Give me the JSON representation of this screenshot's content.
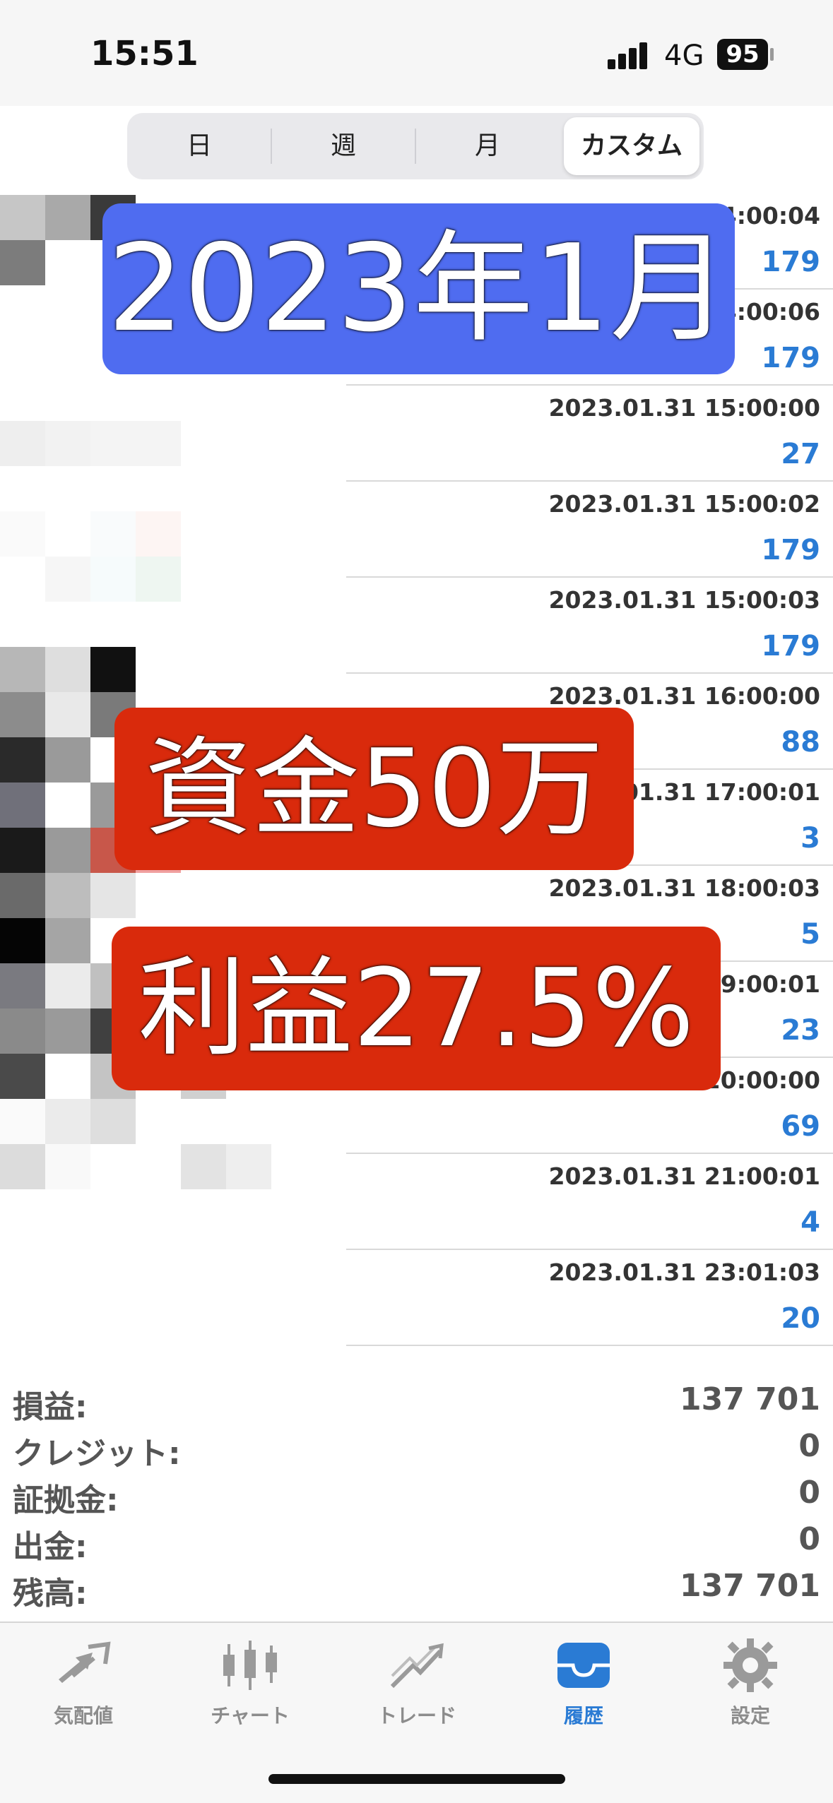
{
  "status_bar": {
    "time": "15:51",
    "network": "4G",
    "battery": "95"
  },
  "segmented": {
    "items": [
      "日",
      "週",
      "月",
      "カスタム"
    ],
    "selected": "カスタム"
  },
  "rows": [
    {
      "date": "14:00:04",
      "value": "179"
    },
    {
      "date": "14:00:06",
      "value": "179"
    },
    {
      "date": "2023.01.31 15:00:00",
      "value": "27"
    },
    {
      "date": "2023.01.31 15:00:02",
      "value": "179"
    },
    {
      "date": "2023.01.31 15:00:03",
      "value": "179"
    },
    {
      "date": "2023.01.31 16:00:00",
      "value": "88"
    },
    {
      "date": "2023.01.31 17:00:01",
      "value": "3"
    },
    {
      "date": "2023.01.31 18:00:03",
      "value": "5"
    },
    {
      "date": "19:00:01",
      "value": "23"
    },
    {
      "date": "2023.01.31 20:00:00",
      "value": "69"
    },
    {
      "date": "2023.01.31 21:00:01",
      "value": "4"
    },
    {
      "date": "2023.01.31 23:01:03",
      "value": "20"
    }
  ],
  "overlays": {
    "month": "2023年1月",
    "capital": "資金50万",
    "profit": "利益27.5%"
  },
  "summary": [
    {
      "label": "損益:",
      "value": "137 701"
    },
    {
      "label": "クレジット:",
      "value": "0"
    },
    {
      "label": "証拠金:",
      "value": "0"
    },
    {
      "label": "出金:",
      "value": "0"
    },
    {
      "label": "残高:",
      "value": "137 701"
    }
  ],
  "tabs": [
    {
      "label": "気配値",
      "icon": "quotes-icon"
    },
    {
      "label": "チャート",
      "icon": "chart-icon"
    },
    {
      "label": "トレード",
      "icon": "trade-icon"
    },
    {
      "label": "履歴",
      "icon": "history-icon"
    },
    {
      "label": "設定",
      "icon": "settings-icon"
    }
  ],
  "active_tab": "履歴",
  "colors": {
    "accent": "#2a7bd4",
    "overlay_blue": "#4f6cf0",
    "overlay_red": "#d92a0c"
  }
}
